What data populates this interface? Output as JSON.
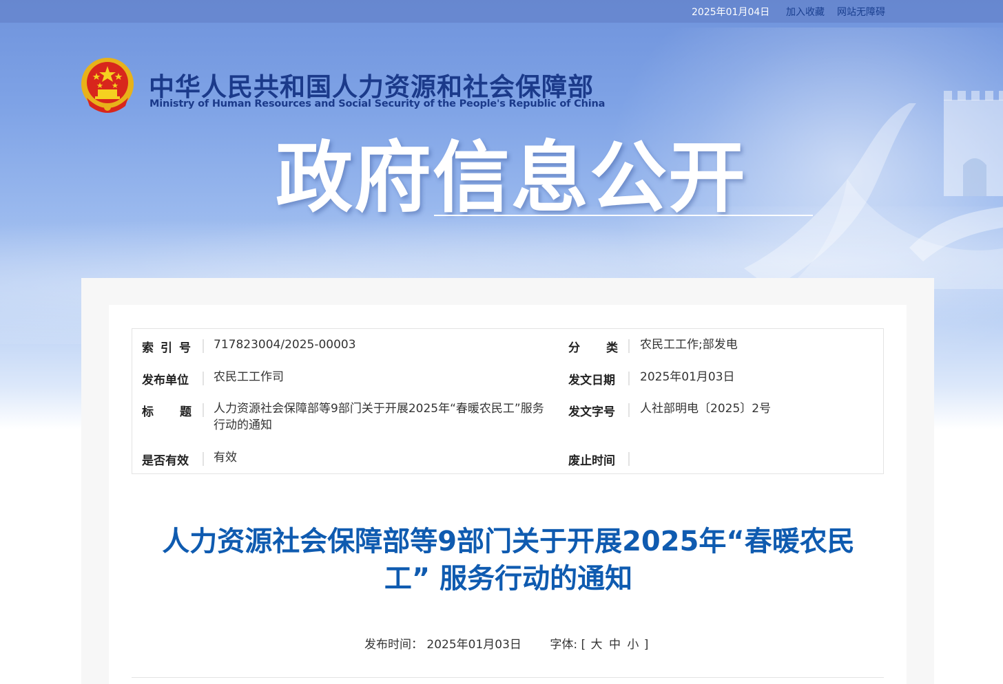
{
  "topbar": {
    "date": "2025年01月04日",
    "add_favorite": "加入收藏",
    "accessibility": "网站无障碍"
  },
  "header": {
    "site_name_cn": "中华人民共和国人力资源和社会保障部",
    "site_name_en": "Ministry of Human Resources and Social Security of the People's Republic of China",
    "section_title": "政府信息公开",
    "colors": {
      "brand": "#1b3a8a",
      "title_blue": "#0f5bb0"
    }
  },
  "meta": {
    "index_no": {
      "label": "索引号",
      "value": "717823004/2025-00003"
    },
    "category": {
      "label": "分类",
      "value": "农民工工作;部发电"
    },
    "publisher": {
      "label": "发布单位",
      "value": "农民工工作司"
    },
    "issue_date": {
      "label": "发文日期",
      "value": "2025年01月03日"
    },
    "title": {
      "label": "标题",
      "value": "人力资源社会保障部等9部门关于开展2025年“春暖农民工”服务行动的通知"
    },
    "doc_no": {
      "label": "发文字号",
      "value": "人社部明电〔2025〕2号"
    },
    "valid": {
      "label": "是否有效",
      "value": "有效"
    },
    "repeal_time": {
      "label": "废止时间",
      "value": ""
    }
  },
  "article": {
    "title_line1": "人力资源社会保障部等9部门关于开展2025年“春暖农民",
    "title_line2": "工” 服务行动的通知",
    "publish_label": "发布时间：",
    "publish_date": "2025年01月03日",
    "font_label": "字体:",
    "font_open": "[",
    "font_large": "大",
    "font_medium": "中",
    "font_small": "小",
    "font_close": "]"
  }
}
